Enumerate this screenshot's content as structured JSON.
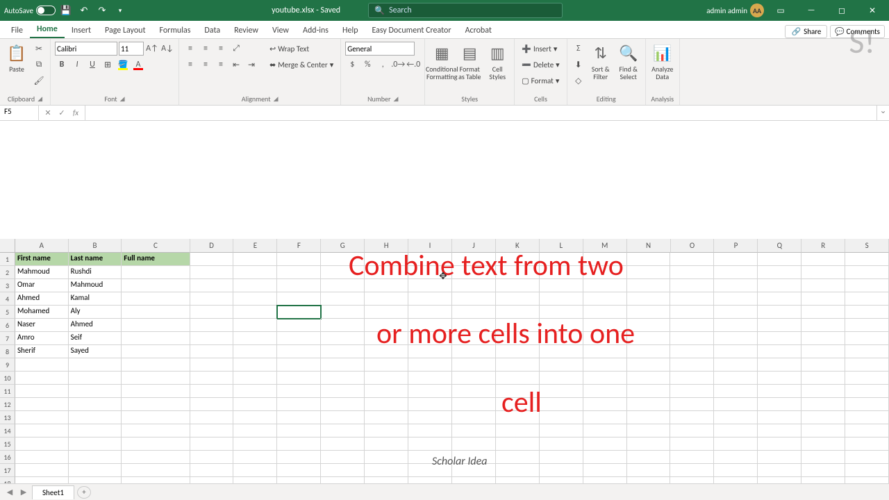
{
  "titlebar": {
    "autosave_label": "AutoSave",
    "doc_title": "youtube.xlsx - Saved",
    "search_placeholder": "Search",
    "user_name": "admin admin",
    "user_initials": "AA"
  },
  "tabs": {
    "file": "File",
    "home": "Home",
    "insert": "Insert",
    "page_layout": "Page Layout",
    "formulas": "Formulas",
    "data": "Data",
    "review": "Review",
    "view": "View",
    "addins": "Add-ins",
    "help": "Help",
    "edc": "Easy Document Creator",
    "acrobat": "Acrobat",
    "share": "Share",
    "comments": "Comments"
  },
  "ribbon": {
    "clipboard": {
      "paste": "Paste",
      "label": "Clipboard"
    },
    "font": {
      "name": "Calibri",
      "size": "11",
      "label": "Font"
    },
    "alignment": {
      "wrap": "Wrap Text",
      "merge": "Merge & Center",
      "label": "Alignment"
    },
    "number": {
      "format": "General",
      "label": "Number"
    },
    "styles": {
      "cond": "Conditional Formatting",
      "table": "Format as Table",
      "cell": "Cell Styles",
      "label": "Styles"
    },
    "cells": {
      "insert": "Insert",
      "delete": "Delete",
      "format": "Format",
      "label": "Cells"
    },
    "editing": {
      "sort": "Sort & Filter",
      "find": "Find & Select",
      "label": "Editing"
    },
    "analysis": {
      "analyze": "Analyze Data",
      "label": "Analysis"
    }
  },
  "formula_bar": {
    "name_box": "F5",
    "formula": ""
  },
  "sheet": {
    "columns": [
      "A",
      "B",
      "C",
      "D",
      "E",
      "F",
      "G",
      "H",
      "I",
      "J",
      "K",
      "L",
      "M",
      "N",
      "O",
      "P",
      "Q",
      "R",
      "S"
    ],
    "row_count": 18,
    "headers": {
      "A": "First name",
      "B": "Last name",
      "C": "Full name"
    },
    "data": [
      {
        "A": "Mahmoud",
        "B": "Rushdi"
      },
      {
        "A": "Omar",
        "B": "Mahmoud"
      },
      {
        "A": "Ahmed",
        "B": "Kamal"
      },
      {
        "A": "Mohamed",
        "B": "Aly"
      },
      {
        "A": "Naser",
        "B": "Ahmed"
      },
      {
        "A": "Amro",
        "B": "Seif"
      },
      {
        "A": "Sherif",
        "B": "Sayed"
      }
    ],
    "selected_cell": "F5"
  },
  "overlay": {
    "line1": "Combine text from two",
    "line2": "or more cells into one",
    "line3": "cell",
    "scholar": "Scholar Idea"
  },
  "tabs_bottom": {
    "sheet1": "Sheet1"
  }
}
